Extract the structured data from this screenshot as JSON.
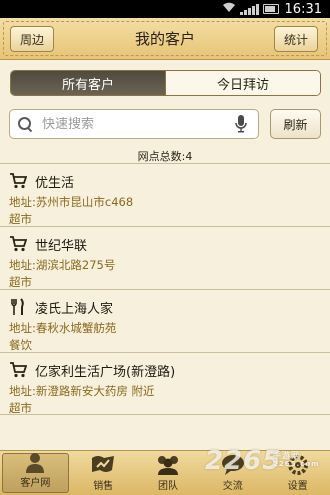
{
  "status_bar": {
    "time": "16:31"
  },
  "header": {
    "left_button": "周边",
    "title": "我的客户",
    "right_button": "统计"
  },
  "tabs": [
    {
      "label": "所有客户",
      "active": true
    },
    {
      "label": "今日拜访",
      "active": false
    }
  ],
  "search": {
    "placeholder": "快速搜索",
    "refresh_label": "刷新"
  },
  "count_text": "网点总数:4",
  "list": [
    {
      "icon": "cart-icon",
      "name": "优生活",
      "address": "地址:苏州市昆山市c468",
      "type": "超市"
    },
    {
      "icon": "cart-icon",
      "name": "世纪华联",
      "address": "地址:湖滨北路275号",
      "type": "超市"
    },
    {
      "icon": "fork-knife-icon",
      "name": "凌氏上海人家",
      "address": "地址:春秋水城蟹舫苑",
      "type": "餐饮"
    },
    {
      "icon": "cart-icon",
      "name": "亿家利生活广场(新澄路)",
      "address": "地址:新澄路新安大药房 附近",
      "type": "超市"
    }
  ],
  "bottom_nav": [
    {
      "label": "客户网",
      "icon": "person-icon",
      "active": true
    },
    {
      "label": "销售",
      "icon": "chart-icon",
      "active": false
    },
    {
      "label": "团队",
      "icon": "team-icon",
      "active": false
    },
    {
      "label": "交流",
      "icon": "chat-icon",
      "active": false
    },
    {
      "label": "设置",
      "icon": "settings-icon",
      "active": false
    }
  ],
  "watermark": {
    "text": "2265",
    "sub": "手游网",
    "site": "2265.com"
  },
  "colors": {
    "header": "#e9c980",
    "background": "#f6f0dc",
    "address_text": "#8a6a1e",
    "active_tab": "#57503f"
  }
}
